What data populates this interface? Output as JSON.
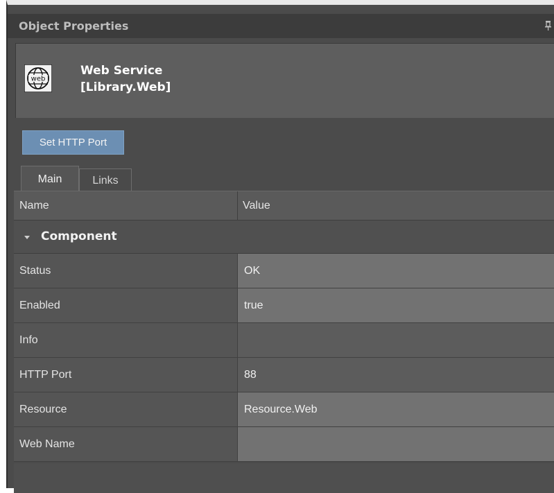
{
  "panel": {
    "title": "Object Properties"
  },
  "object": {
    "name": "Web Service",
    "path": "[Library.Web]",
    "icon_text": "web"
  },
  "actions": {
    "set_http_port": "Set HTTP Port"
  },
  "tabs": [
    {
      "label": "Main",
      "selected": true
    },
    {
      "label": "Links",
      "selected": false
    }
  ],
  "grid": {
    "columns": [
      "Name",
      "Value"
    ],
    "group": "Component",
    "rows": [
      {
        "name": "Status",
        "value": "OK"
      },
      {
        "name": "Enabled",
        "value": "true"
      },
      {
        "name": "Info",
        "value": ""
      },
      {
        "name": "HTTP Port",
        "value": "88"
      },
      {
        "name": "Resource",
        "value": "Resource.Web"
      },
      {
        "name": "Web Name",
        "value": ""
      }
    ]
  },
  "icons": {
    "pin": "pin-icon",
    "web": "web-globe-icon",
    "expand": "chevron-down-icon"
  }
}
